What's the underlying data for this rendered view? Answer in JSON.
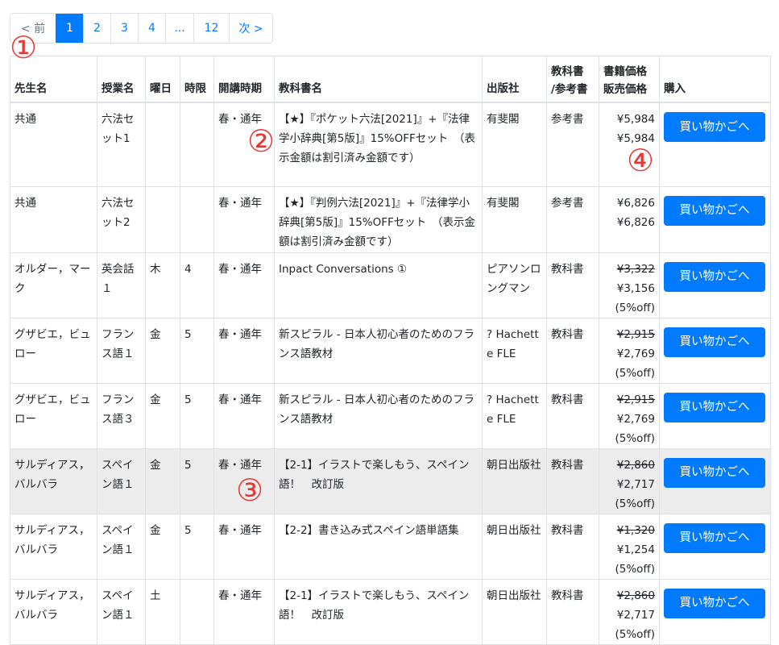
{
  "pagination": {
    "prev": "< 前",
    "pages": [
      "1",
      "2",
      "3",
      "4",
      "...",
      "12"
    ],
    "next": "次 >",
    "active": "1"
  },
  "headers": {
    "teacher": "先生名",
    "course": "授業名",
    "day": "曜日",
    "period": "時限",
    "term": "開講時期",
    "textbook": "教科書名",
    "publisher": "出版社",
    "type": "教科書\n/参考書",
    "price": "書籍価格\n販売価格",
    "buy": "購入"
  },
  "buy_label": "買い物かごへ",
  "rows": [
    {
      "teacher": "共通",
      "course": "六法セット1",
      "day": "",
      "period": "",
      "term": "春・通年",
      "textbook": "【★】『ポケット六法[2021]』+『法律学小辞典[第5版]』15%OFFセット　（表示金額は割引済み金額です）",
      "publisher": "有斐閣",
      "type": "参考書",
      "list_price": "¥5,984",
      "sale_price": "¥5,984",
      "discount": "",
      "strike": false,
      "highlight": false
    },
    {
      "teacher": "共通",
      "course": "六法セット2",
      "day": "",
      "period": "",
      "term": "春・通年",
      "textbook": "【★】『判例六法[2021]』+『法律学小辞典[第5版]』15%OFFセット　（表示金額は割引済み金額です）",
      "publisher": "有斐閣",
      "type": "参考書",
      "list_price": "¥6,826",
      "sale_price": "¥6,826",
      "discount": "",
      "strike": false,
      "highlight": false
    },
    {
      "teacher": "オルダー，マーク",
      "course": "英会話１",
      "day": "木",
      "period": "4",
      "term": "春・通年",
      "textbook": "Inpact Conversations ①",
      "publisher": "ピアソンロングマン",
      "type": "教科書",
      "list_price": "¥3,322",
      "sale_price": "¥3,156",
      "discount": "(5%off)",
      "strike": true,
      "highlight": false
    },
    {
      "teacher": "グザビエ，ビュロー",
      "course": "フランス語１",
      "day": "金",
      "period": "5",
      "term": "春・通年",
      "textbook": "新スピラル - 日本人初心者のためのフランス語教材",
      "publisher": "? Hachette FLE",
      "type": "教科書",
      "list_price": "¥2,915",
      "sale_price": "¥2,769",
      "discount": "(5%off)",
      "strike": true,
      "highlight": false
    },
    {
      "teacher": "グザビエ，ビュロー",
      "course": "フランス語３",
      "day": "金",
      "period": "5",
      "term": "春・通年",
      "textbook": "新スピラル - 日本人初心者のためのフランス語教材",
      "publisher": "? Hachette FLE",
      "type": "教科書",
      "list_price": "¥2,915",
      "sale_price": "¥2,769",
      "discount": "(5%off)",
      "strike": true,
      "highlight": false
    },
    {
      "teacher": "サルディアス，バルバラ",
      "course": "スペイン語１",
      "day": "金",
      "period": "5",
      "term": "春・通年",
      "textbook": "【2-1】イラストで楽しもう、スペイン語！　改訂版",
      "publisher": "朝日出版社",
      "type": "教科書",
      "list_price": "¥2,860",
      "sale_price": "¥2,717",
      "discount": "(5%off)",
      "strike": true,
      "highlight": true
    },
    {
      "teacher": "サルディアス，バルバラ",
      "course": "スペイン語１",
      "day": "金",
      "period": "5",
      "term": "春・通年",
      "textbook": "【2-2】書き込み式スペイン語単語集",
      "publisher": "朝日出版社",
      "type": "教科書",
      "list_price": "¥1,320",
      "sale_price": "¥1,254",
      "discount": "(5%off)",
      "strike": true,
      "highlight": false
    },
    {
      "teacher": "サルディアス，バルバラ",
      "course": "スペイン語１",
      "day": "土",
      "period": "",
      "term": "春・通年",
      "textbook": "【2-1】イラストで楽しもう、スペイン語！　改訂版",
      "publisher": "朝日出版社",
      "type": "教科書",
      "list_price": "¥2,860",
      "sale_price": "¥2,717",
      "discount": "(5%off)",
      "strike": true,
      "highlight": false
    }
  ],
  "annotations": [
    "①",
    "②",
    "③",
    "④"
  ],
  "colors": {
    "accent": "#007bff",
    "annotation": "#e53935",
    "highlight_row": "#ececec"
  }
}
